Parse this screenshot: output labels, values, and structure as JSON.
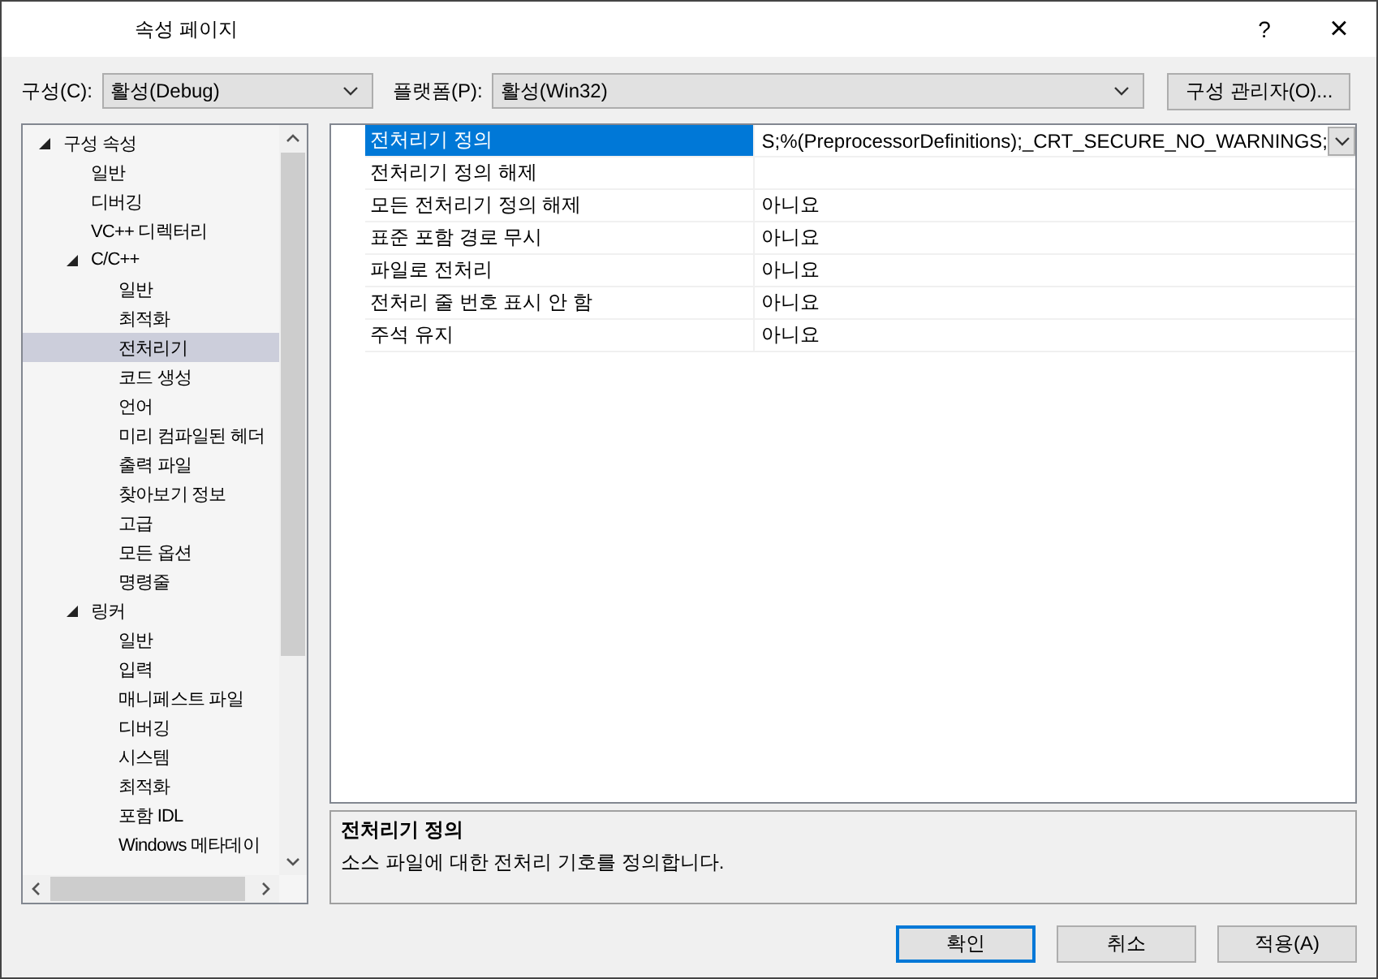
{
  "window": {
    "title": "속성 페이지",
    "help_button": "?",
    "close_button": "×"
  },
  "toolbar": {
    "config_label": "구성(C):",
    "config_value": "활성(Debug)",
    "platform_label": "플랫폼(P):",
    "platform_value": "활성(Win32)",
    "manager_button": "구성 관리자(O)..."
  },
  "tree": [
    {
      "label": "구성 속성",
      "expanded": true,
      "selected": false,
      "children": [
        {
          "label": "일반",
          "selected": false
        },
        {
          "label": "디버깅",
          "selected": false
        },
        {
          "label": "VC++ 디렉터리",
          "selected": false
        },
        {
          "label": "C/C++",
          "expanded": true,
          "selected": false,
          "children": [
            {
              "label": "일반",
              "selected": false
            },
            {
              "label": "최적화",
              "selected": false
            },
            {
              "label": "전처리기",
              "selected": true
            },
            {
              "label": "코드 생성",
              "selected": false
            },
            {
              "label": "언어",
              "selected": false
            },
            {
              "label": "미리 컴파일된 헤더",
              "selected": false
            },
            {
              "label": "출력 파일",
              "selected": false
            },
            {
              "label": "찾아보기 정보",
              "selected": false
            },
            {
              "label": "고급",
              "selected": false
            },
            {
              "label": "모든 옵션",
              "selected": false
            },
            {
              "label": "명령줄",
              "selected": false
            }
          ]
        },
        {
          "label": "링커",
          "expanded": true,
          "selected": false,
          "children": [
            {
              "label": "일반",
              "selected": false
            },
            {
              "label": "입력",
              "selected": false
            },
            {
              "label": "매니페스트 파일",
              "selected": false
            },
            {
              "label": "디버깅",
              "selected": false
            },
            {
              "label": "시스템",
              "selected": false
            },
            {
              "label": "최적화",
              "selected": false
            },
            {
              "label": "포함 IDL",
              "selected": false
            },
            {
              "label": "Windows 메타데이",
              "selected": false
            }
          ]
        }
      ]
    }
  ],
  "grid": [
    {
      "name": "전처리기 정의",
      "value": "S;%(PreprocessorDefinitions);_CRT_SECURE_NO_WARNINGS;",
      "selected": true
    },
    {
      "name": "전처리기 정의 해제",
      "selected": false
    },
    {
      "name": "모든 전처리기 정의 해제",
      "value": "아니요",
      "selected": false
    },
    {
      "name": "표준 포함 경로 무시",
      "value": "아니요",
      "selected": false
    },
    {
      "name": "파일로 전처리",
      "value": "아니요",
      "selected": false
    },
    {
      "name": "전처리 줄 번호 표시 안 함",
      "value": "아니요",
      "selected": false
    },
    {
      "name": "주석 유지",
      "value": "아니요",
      "selected": false
    }
  ],
  "description": {
    "title": "전처리기 정의",
    "text": "소스 파일에 대한 전처리 기호를 정의합니다."
  },
  "buttons": [
    {
      "label": "확인",
      "default": true
    },
    {
      "label": "취소",
      "default": false
    },
    {
      "label": "적용(A)",
      "default": false
    }
  ]
}
